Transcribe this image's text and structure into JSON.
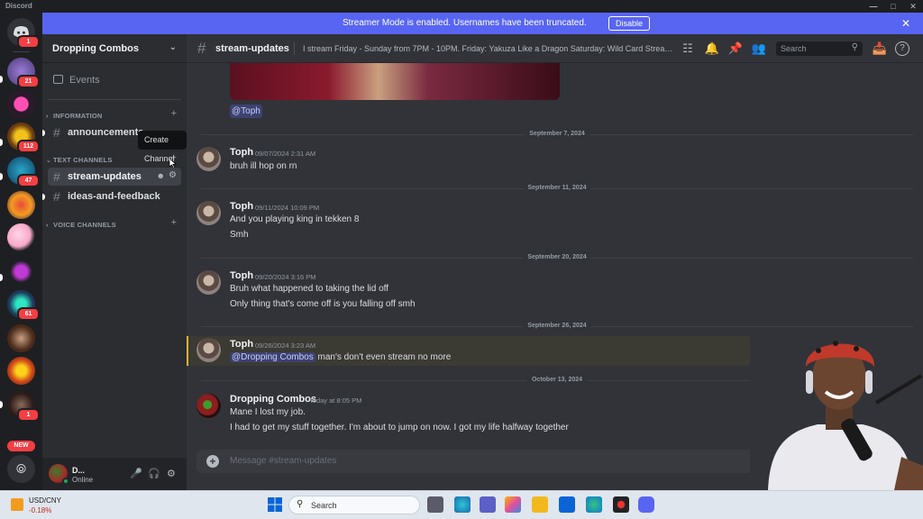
{
  "window": {
    "title": "Discord"
  },
  "guild_rail": {
    "home_badge": "1",
    "badges": [
      "21",
      "112",
      "47",
      "61",
      "1"
    ],
    "new_label": "NEW"
  },
  "banner": {
    "text": "Streamer Mode is enabled. Usernames have been truncated.",
    "disable_label": "Disable"
  },
  "server": {
    "name": "Dropping Combos"
  },
  "sidebar": {
    "events_label": "Events",
    "categories": {
      "information": "INFORMATION",
      "text": "TEXT CHANNELS",
      "voice": "VOICE CHANNELS"
    },
    "channels": {
      "announcements": "announcements",
      "stream_updates": "stream-updates",
      "ideas": "ideas-and-feedback"
    },
    "tooltip": "Create Channel"
  },
  "user": {
    "name": "D...",
    "status": "Online"
  },
  "topbar": {
    "channel": "stream-updates",
    "topic": "I stream Friday - Sunday from 7PM - 10PM. Friday: Yakuza Like a Dragon Saturday: Wild Card Stream Sunday: Tekken 8",
    "search_placeholder": "Search"
  },
  "messages": {
    "top_mention": "@Toph",
    "d1": "September 7, 2024",
    "m1": {
      "author": "Toph",
      "time": "09/07/2024 2:31 AM",
      "lines": [
        "bruh ill hop on rn"
      ]
    },
    "d2": "September 11, 2024",
    "m2": {
      "author": "Toph",
      "time": "09/11/2024 10:09 PM",
      "lines": [
        "And you playing king in tekken 8",
        "Smh"
      ]
    },
    "d3": "September 20, 2024",
    "m3": {
      "author": "Toph",
      "time": "09/20/2024 3:16 PM",
      "lines": [
        "Bruh what happened to taking the lid off",
        "Only thing that's come off is you falling off smh"
      ]
    },
    "d4": "September 26, 2024",
    "m4": {
      "author": "Toph",
      "time": "09/26/2024 3:23 AM",
      "mention": "@Dropping Combos",
      "rest": " man's don't even stream no more"
    },
    "d5": "October 13, 2024",
    "m5": {
      "author": "Dropping Combos",
      "time": "Today at 8:05 PM",
      "lines": [
        "Mane I lost my job.",
        "I had to get my stuff together. I'm about to jump on now. I got my life halfway together"
      ]
    }
  },
  "composer": {
    "placeholder": "Message #stream-updates"
  },
  "taskbar": {
    "widget_title": "USD/CNY",
    "widget_value": "-0.18%",
    "search_placeholder": "Search"
  },
  "colors": {
    "blurple": "#5865f2",
    "mention_bg": "#3c4270",
    "highlight_bar": "#f0b232",
    "online": "#23a55a",
    "badge": "#f23f43"
  }
}
